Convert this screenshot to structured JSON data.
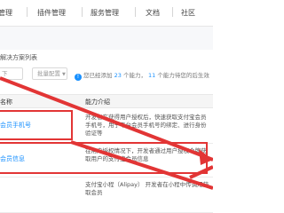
{
  "topnav": {
    "items": [
      {
        "label": "管理"
      },
      {
        "label": "插件管理"
      },
      {
        "label": "服务管理"
      },
      {
        "label": "文档"
      },
      {
        "label": "社区"
      }
    ]
  },
  "breadcrumb": {
    "text": "解决方案列表"
  },
  "toolbar": {
    "batch_label": "下",
    "config_label": "批量配置",
    "status_prefix": "您已经添加",
    "added_count": "23",
    "status_middle": "个能力，",
    "pending_count": "11",
    "status_suffix": "个能力待您的后生效"
  },
  "table": {
    "columns": [
      "名称",
      "能力介绍"
    ],
    "rows": [
      {
        "name": "会员手机号",
        "desc": "开发者在获得用户授权后，快速获取支付宝会员手机号，用于平台会员手机号的绑定、进行身份验证等"
      },
      {
        "name": "会员信息",
        "desc": "在用户授权情况下，开发者通过用户授权令牌获取用户的支付宝会员信息"
      },
      {
        "name": "",
        "desc": "支付宝小程（Alipay）  开发者在小程中传调用获取会员"
      }
    ]
  },
  "colors": {
    "accent": "#1890ff",
    "highlight": "#e23535",
    "header_bg": "#f5f5f5"
  }
}
